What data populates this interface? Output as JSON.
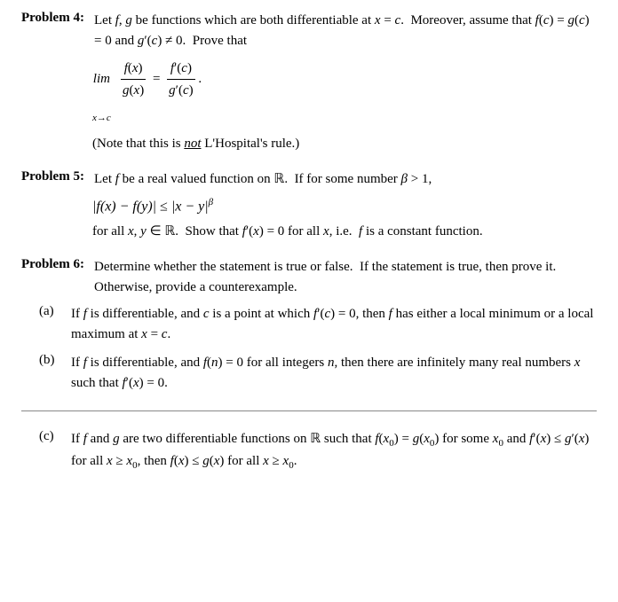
{
  "problems": [
    {
      "id": "4",
      "label": "Problem 4:",
      "intro": "Let <i>f</i>, <i>g</i> be functions which are both differentiable at <i>x</i> = <i>c</i>.  Moreover, assume that <i>f</i>(<i>c</i>) = <i>g</i>(<i>c</i>) = 0 and <i>g</i>′(<i>c</i>) ≠ 0.  Prove that",
      "formula": "lim_{x→c} f(x)/g(x) = f'(c)/g'(c)",
      "note": "(Note that this is <u>not</u> L'Hospital's rule.)"
    },
    {
      "id": "5",
      "label": "Problem 5:",
      "intro": "Let <i>f</i> be a real valued function on ℝ.  If for some number β > 1,",
      "formula": "|f(x) − f(y)| ≤ |x − y|^β",
      "conclusion": "for all <i>x</i>, <i>y</i> ∈ ℝ.  Show that <i>f</i>′(<i>x</i>) = 0 for all <i>x</i>, i.e.  <i>f</i> is a constant function."
    },
    {
      "id": "6",
      "label": "Problem 6:",
      "intro": "Determine whether the statement is true or false.  If the statement is true, then prove it.  Otherwise, provide a counterexample.",
      "subproblems": [
        {
          "label": "(a)",
          "text": "If <i>f</i> is differentiable, and <i>c</i> is a point at which <i>f</i>′(<i>c</i>) = 0, then <i>f</i> has either a local minimum or a local maximum at <i>x</i> = <i>c</i>."
        },
        {
          "label": "(b)",
          "text": "If <i>f</i> is differentiable, and <i>f</i>(<i>n</i>) = 0 for all integers <i>n</i>, then there are infinitely many real numbers <i>x</i> such that <i>f</i>′(<i>x</i>) = 0."
        },
        {
          "label": "(c)",
          "text": "If <i>f</i> and <i>g</i> are two differentiable functions on ℝ such that <i>f</i>(<i>x</i><sub>0</sub>) = <i>g</i>(<i>x</i><sub>0</sub>) for some <i>x</i><sub>0</sub> and <i>f</i>′(<i>x</i>) ≤ <i>g</i>′(<i>x</i>) for all <i>x</i> ≥ <i>x</i><sub>0</sub>, then <i>f</i>(<i>x</i>) ≤ <i>g</i>(<i>x</i>) for all <i>x</i> ≥ <i>x</i><sub>0</sub>."
        }
      ]
    }
  ]
}
